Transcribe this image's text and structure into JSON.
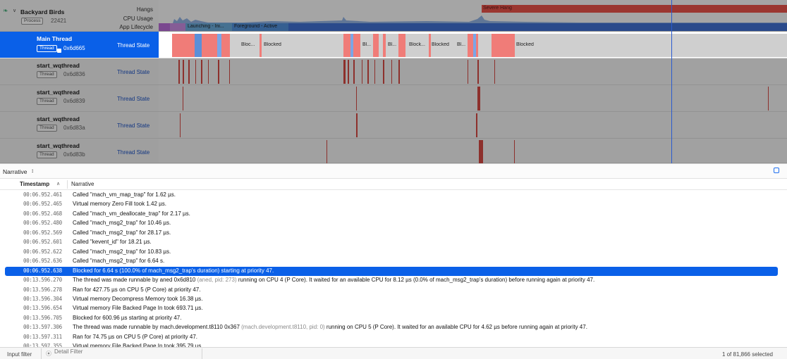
{
  "process": {
    "name": "Backyard Birds",
    "badge": "Process",
    "pid": "22421",
    "tracks": [
      "Hangs",
      "CPU Usage",
      "App Lifecycle"
    ],
    "hang_label": "Severe Hang",
    "lifecycle_segments": [
      "Launching - Ini...",
      "Foreground - Active"
    ]
  },
  "threads": [
    {
      "name": "Main Thread",
      "badge": "Thread",
      "id": "0x6d665",
      "state": "Thread State",
      "selected": true
    },
    {
      "name": "start_wqthread",
      "badge": "Thread",
      "id": "0x6d836",
      "state": "Thread State"
    },
    {
      "name": "start_wqthread",
      "badge": "Thread",
      "id": "0x6d839",
      "state": "Thread State"
    },
    {
      "name": "start_wqthread",
      "badge": "Thread",
      "id": "0x6d83a",
      "state": "Thread State"
    },
    {
      "name": "start_wqthread",
      "badge": "Thread",
      "id": "0x6d83b",
      "state": "Thread State"
    }
  ],
  "main_thread_labels": [
    "Bloc...",
    "Blocked",
    "Bl...",
    "Bl...",
    "Block...",
    "Blocked",
    "Bl...",
    "Blocked"
  ],
  "narrative": {
    "selector": "Narrative",
    "col_timestamp": "Timestamp",
    "col_narrative": "Narrative",
    "rows": [
      {
        "ts": "00:06.952.461",
        "text": "Called \"mach_vm_map_trap\" for 1.62 µs."
      },
      {
        "ts": "00:06.952.465",
        "text": "Virtual memory Zero Fill took 1.42 µs."
      },
      {
        "ts": "00:06.952.468",
        "text": "Called \"mach_vm_deallocate_trap\" for 2.17 µs."
      },
      {
        "ts": "00:06.952.480",
        "text": "Called \"mach_msg2_trap\" for 10.46 µs."
      },
      {
        "ts": "00:06.952.569",
        "text": "Called \"mach_msg2_trap\" for 28.17 µs."
      },
      {
        "ts": "00:06.952.601",
        "text": "Called \"kevent_id\" for 18.21 µs."
      },
      {
        "ts": "00:06.952.622",
        "text": "Called \"mach_msg2_trap\" for 10.83 µs."
      },
      {
        "ts": "00:06.952.636",
        "text": "Called \"mach_msg2_trap\" for 6.64 s."
      },
      {
        "ts": "00:06.952.638",
        "text": "Blocked for 6.64 s (100.0% of mach_msg2_trap's duration) starting at priority 47.",
        "selected": true
      },
      {
        "ts": "00:13.596.270",
        "text": "The thread was made runnable by aned  0x6d810",
        "gray": " (aned, pid: 273)",
        "text2": " running on CPU 4 (P Core). It waited for an available CPU for 8.12 µs (0.0% of mach_msg2_trap's duration) before running again at priority 47."
      },
      {
        "ts": "00:13.596.278",
        "text": "Ran for 427.75 µs on CPU 5 (P Core) at priority 47."
      },
      {
        "ts": "00:13.596.304",
        "text": "Virtual memory Decompress Memory took 16.38 µs."
      },
      {
        "ts": "00:13.596.654",
        "text": "Virtual memory File Backed Page In took 693.71 µs."
      },
      {
        "ts": "00:13.596.705",
        "text": "Blocked for 600.96 µs starting at priority 47."
      },
      {
        "ts": "00:13.597.306",
        "text": "The thread was made runnable by mach.development.t8110  0x367",
        "gray": " (mach.development.t8110, pid: 0)",
        "text2": " running on CPU 5 (P Core). It waited for an available CPU for 4.62 µs before running again at priority 47."
      },
      {
        "ts": "00:13.597.311",
        "text": "Ran for 74.75 µs on CPU 5 (P Core) at priority 47."
      },
      {
        "ts": "00:13.597.355",
        "text": "Virtual memory File Backed Page In took 395.79 µs."
      }
    ]
  },
  "footer": {
    "input_filter": "Input filter",
    "detail_filter_placeholder": "Detail Filter",
    "selection_count": "1 of 81,866 selected"
  },
  "colors": {
    "accent": "#0a60e8",
    "running": "#f07c78",
    "blocked": "#c9c9c9",
    "hang": "#e8534a",
    "lifecycle": "#3f6fd0"
  }
}
